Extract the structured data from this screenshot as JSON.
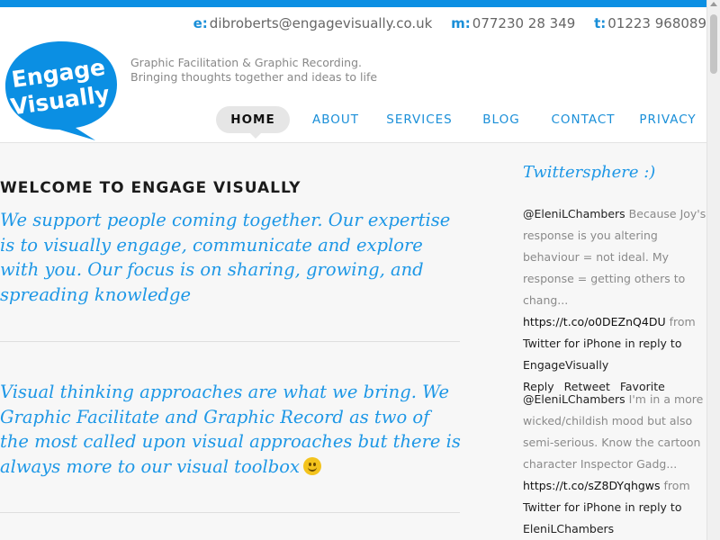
{
  "header": {
    "contacts": [
      {
        "key": "e:",
        "value": "dibroberts@engagevisually.co.uk"
      },
      {
        "key": "m:",
        "value": "077230 28 349"
      },
      {
        "key": "t:",
        "value": "01223 968089"
      }
    ],
    "logo": {
      "line1": "Engage",
      "line2": "Visually"
    },
    "tagline": {
      "line1": "Graphic Facilitation & Graphic Recording.",
      "line2": "Bringing thoughts together and ideas to life"
    }
  },
  "nav": [
    {
      "label": "HOME",
      "active": true
    },
    {
      "label": "ABOUT"
    },
    {
      "label": "SERVICES"
    },
    {
      "label": "BLOG"
    },
    {
      "label": "CONTACT"
    },
    {
      "label": "PRIVACY"
    }
  ],
  "main": {
    "title": "WELCOME TO ENGAGE VISUALLY",
    "intro": "We support people coming together. Our expertise is to visually engage, communicate and explore with you. Our focus is on sharing, growing, and spreading knowledge",
    "approach": "Visual thinking approaches are what we bring. We Graphic Facilitate and Graphic Record as two of the most called upon visual approaches but there is always more to our visual toolbox"
  },
  "sidebar": {
    "title": "Twittersphere :)",
    "tweets": [
      {
        "user": "@EleniLChambers",
        "text": "Because Joy's response is you altering behaviour = not ideal. My response = getting others to chang...",
        "link": "https://t.co/o0DEZnQ4DU",
        "from_label": "from",
        "client": "Twitter for iPhone",
        "reply_label": "in reply to",
        "reply_to": "EngageVisually",
        "actions": [
          "Reply",
          "Retweet",
          "Favorite"
        ]
      },
      {
        "user": "@EleniLChambers",
        "text": "I'm in a more wicked/childish mood but also semi-serious. Know the cartoon character Inspector Gadg...",
        "link": "https://t.co/sZ8DYqhgws",
        "from_label": "from",
        "client": "Twitter for iPhone",
        "reply_label": "in reply to",
        "reply_to": "EleniLChambers"
      }
    ]
  },
  "colors": {
    "brand": "#1d97e6",
    "topbar": "#0b8fe3"
  }
}
